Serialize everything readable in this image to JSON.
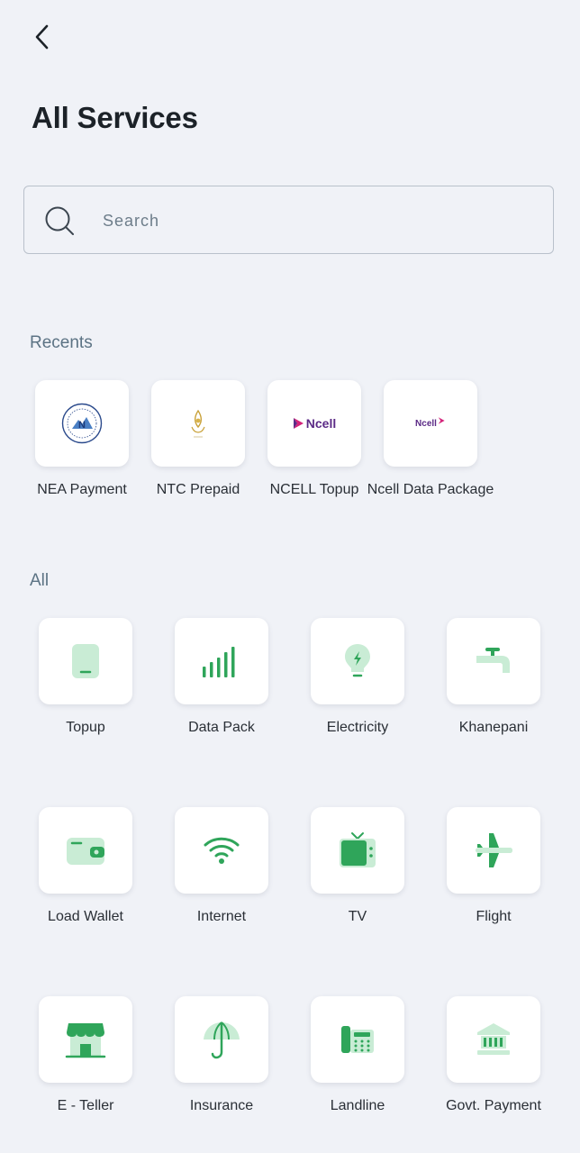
{
  "header": {
    "title": "All Services"
  },
  "search": {
    "placeholder": "Search"
  },
  "recents": {
    "heading": "Recents",
    "items": [
      {
        "label": "NEA Payment"
      },
      {
        "label": "NTC Prepaid"
      },
      {
        "label": "NCELL Topup",
        "logo_text": "Ncell"
      },
      {
        "label": "Ncell Data Package",
        "logo_text": "Ncell"
      }
    ]
  },
  "all": {
    "heading": "All",
    "items": [
      {
        "label": "Topup",
        "icon": "mobile-phone-icon"
      },
      {
        "label": "Data Pack",
        "icon": "signal-bars-icon"
      },
      {
        "label": "Electricity",
        "icon": "lightbulb-icon"
      },
      {
        "label": "Khanepani",
        "icon": "water-tap-icon"
      },
      {
        "label": "Load Wallet",
        "icon": "wallet-icon"
      },
      {
        "label": "Internet",
        "icon": "wifi-icon"
      },
      {
        "label": "TV",
        "icon": "tv-icon"
      },
      {
        "label": "Flight",
        "icon": "airplane-icon"
      },
      {
        "label": "E - Teller",
        "icon": "store-icon"
      },
      {
        "label": "Insurance",
        "icon": "umbrella-icon"
      },
      {
        "label": "Landline",
        "icon": "telephone-icon"
      },
      {
        "label": "Govt. Payment",
        "icon": "government-building-icon"
      }
    ]
  },
  "colors": {
    "accent_green": "#2fa55a",
    "light_green": "#c9ecd5",
    "background": "#f0f2f7",
    "ncell_purple": "#5b2a86",
    "ncell_magenta": "#d4237a"
  }
}
